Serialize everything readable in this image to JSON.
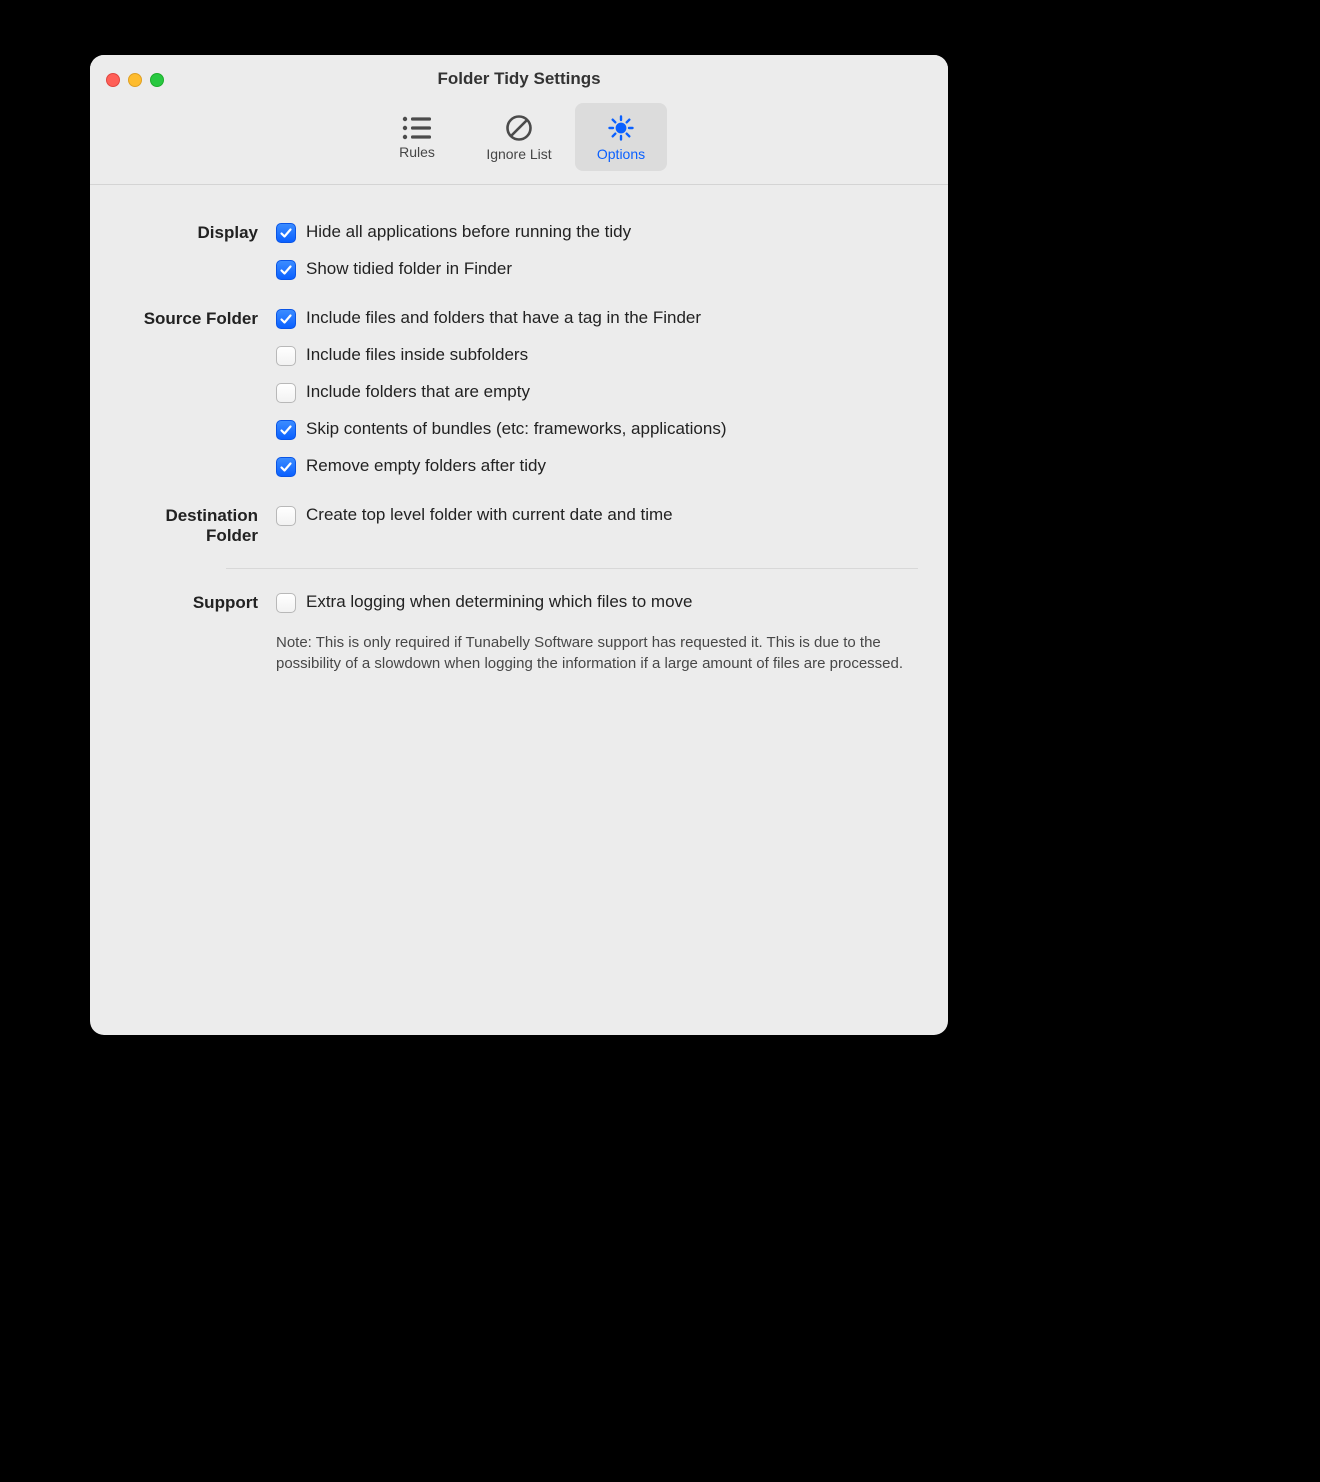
{
  "window": {
    "title": "Folder Tidy Settings"
  },
  "toolbar": {
    "rules_label": "Rules",
    "ignore_label": "Ignore List",
    "options_label": "Options"
  },
  "sections": {
    "display": {
      "heading": "Display",
      "hide_apps": {
        "checked": true,
        "label": "Hide all applications before running the tidy"
      },
      "show_finder": {
        "checked": true,
        "label": "Show tidied folder in Finder"
      }
    },
    "source": {
      "heading": "Source Folder",
      "include_tagged": {
        "checked": true,
        "label": "Include files and folders that have a tag in the Finder"
      },
      "include_subfolders": {
        "checked": false,
        "label": "Include files inside subfolders"
      },
      "include_empty": {
        "checked": false,
        "label": "Include folders that are empty"
      },
      "skip_bundles": {
        "checked": true,
        "label": "Skip contents of bundles (etc: frameworks, applications)"
      },
      "remove_empty": {
        "checked": true,
        "label": "Remove empty folders after tidy"
      }
    },
    "destination": {
      "heading": "Destination Folder",
      "create_dated": {
        "checked": false,
        "label": "Create top level folder with current date and time"
      }
    },
    "support": {
      "heading": "Support",
      "extra_logging": {
        "checked": false,
        "label": "Extra logging when determining which files to move"
      },
      "note": "Note: This is only required if Tunabelly Software support has requested it. This is due to the possibility of a slowdown when logging the information if a large amount of files are processed."
    }
  }
}
